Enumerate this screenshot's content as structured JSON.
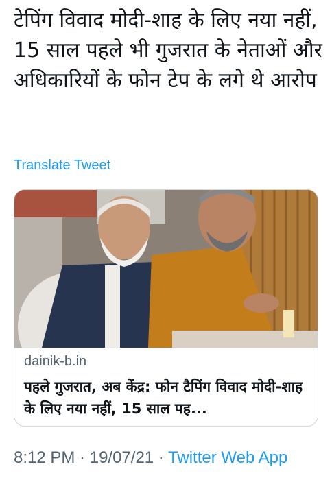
{
  "tweet": {
    "text": "टेपिंग विवाद मोदी-शाह के लिए नया नहीं, 15 साल पहले भी गुजरात के नेताओं और अधिकारियों के फोन टेप के लगे थे आरोप",
    "translate_label": "Translate Tweet"
  },
  "card": {
    "domain": "dainik-b.in",
    "title": "पहले गुजरात, अब केंद्र: फोन टैपिंग विवाद मोदी-शाह के लिए नया नहीं, 15 साल पह..."
  },
  "meta": {
    "time": "8:12 PM",
    "separator": " · ",
    "date": "19/07/21",
    "source": "Twitter Web App"
  },
  "colors": {
    "link": "#1d9bf0",
    "secondary_text": "#536471",
    "border": "#cfd9de"
  }
}
